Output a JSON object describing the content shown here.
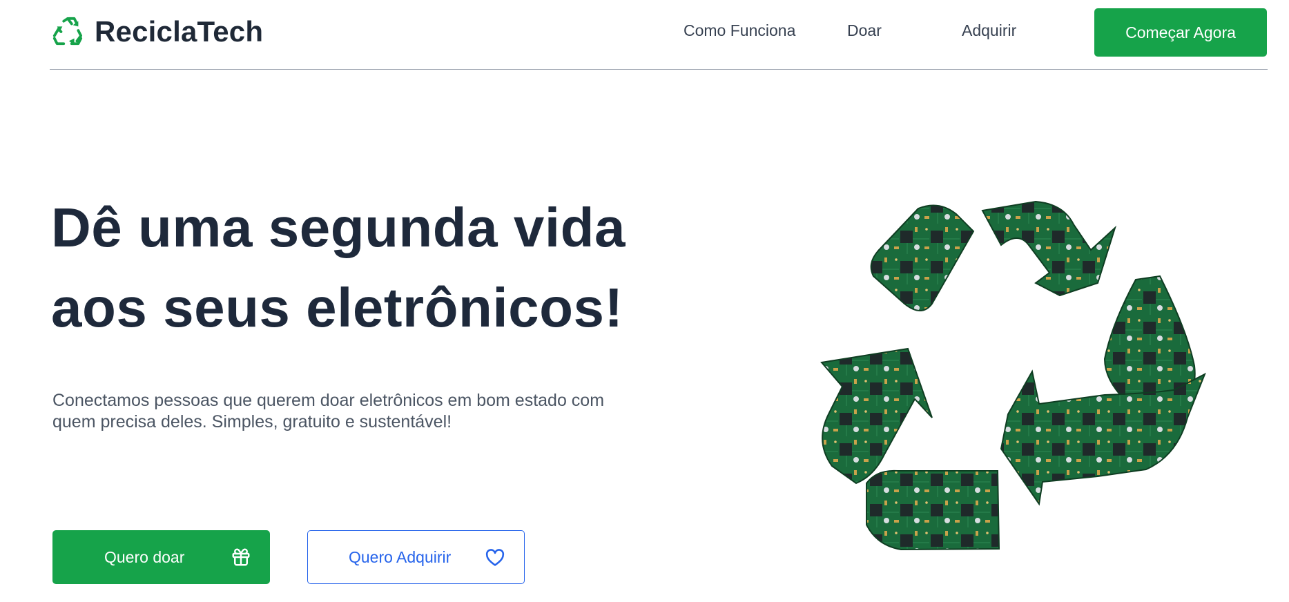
{
  "header": {
    "brand": "ReciclaTech",
    "nav": [
      {
        "label": "Como Funciona"
      },
      {
        "label": "Doar"
      },
      {
        "label": "Adquirir"
      }
    ],
    "cta_label": "Começar Agora"
  },
  "hero": {
    "title_line1": "Dê uma segunda vida",
    "title_line2": "aos seus eletrônicos!",
    "subtitle": "Conectamos pessoas que querem doar eletrônicos em bom estado com quem precisa deles. Simples, gratuito e sustentável!",
    "donate_label": "Quero doar",
    "acquire_label": "Quero Adquirir"
  },
  "icons": {
    "logo": "recycle-icon",
    "donate": "gift-icon",
    "acquire": "heart-icon",
    "illustration": "circuit-board-recycle-symbol"
  },
  "colors": {
    "primary_green": "#16a34a",
    "accent_blue": "#2563eb",
    "heading": "#1e293b",
    "pcb_green": "#1a6b3c"
  }
}
